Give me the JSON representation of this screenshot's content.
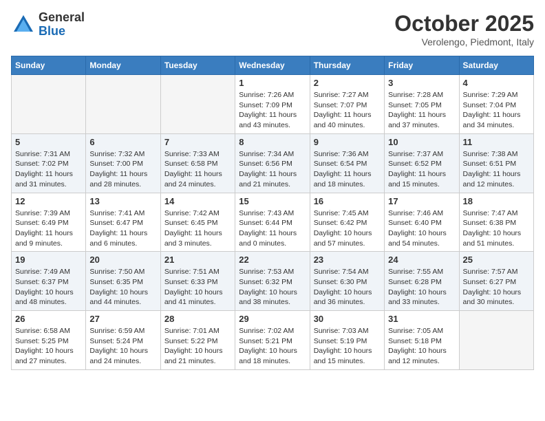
{
  "header": {
    "logo_general": "General",
    "logo_blue": "Blue",
    "month": "October 2025",
    "location": "Verolengo, Piedmont, Italy"
  },
  "weekdays": [
    "Sunday",
    "Monday",
    "Tuesday",
    "Wednesday",
    "Thursday",
    "Friday",
    "Saturday"
  ],
  "weeks": [
    [
      {
        "day": "",
        "info": ""
      },
      {
        "day": "",
        "info": ""
      },
      {
        "day": "",
        "info": ""
      },
      {
        "day": "1",
        "info": "Sunrise: 7:26 AM\nSunset: 7:09 PM\nDaylight: 11 hours and 43 minutes."
      },
      {
        "day": "2",
        "info": "Sunrise: 7:27 AM\nSunset: 7:07 PM\nDaylight: 11 hours and 40 minutes."
      },
      {
        "day": "3",
        "info": "Sunrise: 7:28 AM\nSunset: 7:05 PM\nDaylight: 11 hours and 37 minutes."
      },
      {
        "day": "4",
        "info": "Sunrise: 7:29 AM\nSunset: 7:04 PM\nDaylight: 11 hours and 34 minutes."
      }
    ],
    [
      {
        "day": "5",
        "info": "Sunrise: 7:31 AM\nSunset: 7:02 PM\nDaylight: 11 hours and 31 minutes."
      },
      {
        "day": "6",
        "info": "Sunrise: 7:32 AM\nSunset: 7:00 PM\nDaylight: 11 hours and 28 minutes."
      },
      {
        "day": "7",
        "info": "Sunrise: 7:33 AM\nSunset: 6:58 PM\nDaylight: 11 hours and 24 minutes."
      },
      {
        "day": "8",
        "info": "Sunrise: 7:34 AM\nSunset: 6:56 PM\nDaylight: 11 hours and 21 minutes."
      },
      {
        "day": "9",
        "info": "Sunrise: 7:36 AM\nSunset: 6:54 PM\nDaylight: 11 hours and 18 minutes."
      },
      {
        "day": "10",
        "info": "Sunrise: 7:37 AM\nSunset: 6:52 PM\nDaylight: 11 hours and 15 minutes."
      },
      {
        "day": "11",
        "info": "Sunrise: 7:38 AM\nSunset: 6:51 PM\nDaylight: 11 hours and 12 minutes."
      }
    ],
    [
      {
        "day": "12",
        "info": "Sunrise: 7:39 AM\nSunset: 6:49 PM\nDaylight: 11 hours and 9 minutes."
      },
      {
        "day": "13",
        "info": "Sunrise: 7:41 AM\nSunset: 6:47 PM\nDaylight: 11 hours and 6 minutes."
      },
      {
        "day": "14",
        "info": "Sunrise: 7:42 AM\nSunset: 6:45 PM\nDaylight: 11 hours and 3 minutes."
      },
      {
        "day": "15",
        "info": "Sunrise: 7:43 AM\nSunset: 6:44 PM\nDaylight: 11 hours and 0 minutes."
      },
      {
        "day": "16",
        "info": "Sunrise: 7:45 AM\nSunset: 6:42 PM\nDaylight: 10 hours and 57 minutes."
      },
      {
        "day": "17",
        "info": "Sunrise: 7:46 AM\nSunset: 6:40 PM\nDaylight: 10 hours and 54 minutes."
      },
      {
        "day": "18",
        "info": "Sunrise: 7:47 AM\nSunset: 6:38 PM\nDaylight: 10 hours and 51 minutes."
      }
    ],
    [
      {
        "day": "19",
        "info": "Sunrise: 7:49 AM\nSunset: 6:37 PM\nDaylight: 10 hours and 48 minutes."
      },
      {
        "day": "20",
        "info": "Sunrise: 7:50 AM\nSunset: 6:35 PM\nDaylight: 10 hours and 44 minutes."
      },
      {
        "day": "21",
        "info": "Sunrise: 7:51 AM\nSunset: 6:33 PM\nDaylight: 10 hours and 41 minutes."
      },
      {
        "day": "22",
        "info": "Sunrise: 7:53 AM\nSunset: 6:32 PM\nDaylight: 10 hours and 38 minutes."
      },
      {
        "day": "23",
        "info": "Sunrise: 7:54 AM\nSunset: 6:30 PM\nDaylight: 10 hours and 36 minutes."
      },
      {
        "day": "24",
        "info": "Sunrise: 7:55 AM\nSunset: 6:28 PM\nDaylight: 10 hours and 33 minutes."
      },
      {
        "day": "25",
        "info": "Sunrise: 7:57 AM\nSunset: 6:27 PM\nDaylight: 10 hours and 30 minutes."
      }
    ],
    [
      {
        "day": "26",
        "info": "Sunrise: 6:58 AM\nSunset: 5:25 PM\nDaylight: 10 hours and 27 minutes."
      },
      {
        "day": "27",
        "info": "Sunrise: 6:59 AM\nSunset: 5:24 PM\nDaylight: 10 hours and 24 minutes."
      },
      {
        "day": "28",
        "info": "Sunrise: 7:01 AM\nSunset: 5:22 PM\nDaylight: 10 hours and 21 minutes."
      },
      {
        "day": "29",
        "info": "Sunrise: 7:02 AM\nSunset: 5:21 PM\nDaylight: 10 hours and 18 minutes."
      },
      {
        "day": "30",
        "info": "Sunrise: 7:03 AM\nSunset: 5:19 PM\nDaylight: 10 hours and 15 minutes."
      },
      {
        "day": "31",
        "info": "Sunrise: 7:05 AM\nSunset: 5:18 PM\nDaylight: 10 hours and 12 minutes."
      },
      {
        "day": "",
        "info": ""
      }
    ]
  ]
}
